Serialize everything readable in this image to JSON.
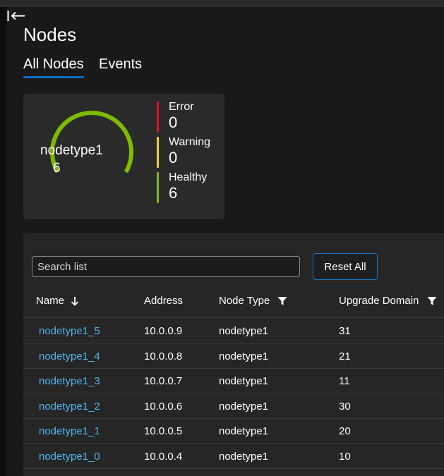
{
  "page": {
    "title": "Nodes"
  },
  "tabs": [
    {
      "label": "All Nodes",
      "active": true
    },
    {
      "label": "Events",
      "active": false
    }
  ],
  "summary": {
    "node_type": "nodetype1",
    "total": "6",
    "ring_color": "#7fba00",
    "stats": [
      {
        "label": "Error",
        "value": "0",
        "color": "#e81123"
      },
      {
        "label": "Warning",
        "value": "0",
        "color": "#fcd116"
      },
      {
        "label": "Healthy",
        "value": "6",
        "color": "#7fba00"
      }
    ]
  },
  "list": {
    "search_placeholder": "Search list",
    "reset_label": "Reset All",
    "columns": [
      "Name",
      "Address",
      "Node Type",
      "Upgrade Domain"
    ],
    "rows": [
      {
        "name": "nodetype1_5",
        "address": "10.0.0.9",
        "node_type": "nodetype1",
        "upgrade_domain": "31"
      },
      {
        "name": "nodetype1_4",
        "address": "10.0.0.8",
        "node_type": "nodetype1",
        "upgrade_domain": "21"
      },
      {
        "name": "nodetype1_3",
        "address": "10.0.0.7",
        "node_type": "nodetype1",
        "upgrade_domain": "11"
      },
      {
        "name": "nodetype1_2",
        "address": "10.0.0.6",
        "node_type": "nodetype1",
        "upgrade_domain": "30"
      },
      {
        "name": "nodetype1_1",
        "address": "10.0.0.5",
        "node_type": "nodetype1",
        "upgrade_domain": "20"
      },
      {
        "name": "nodetype1_0",
        "address": "10.0.0.4",
        "node_type": "nodetype1",
        "upgrade_domain": "10"
      }
    ]
  }
}
